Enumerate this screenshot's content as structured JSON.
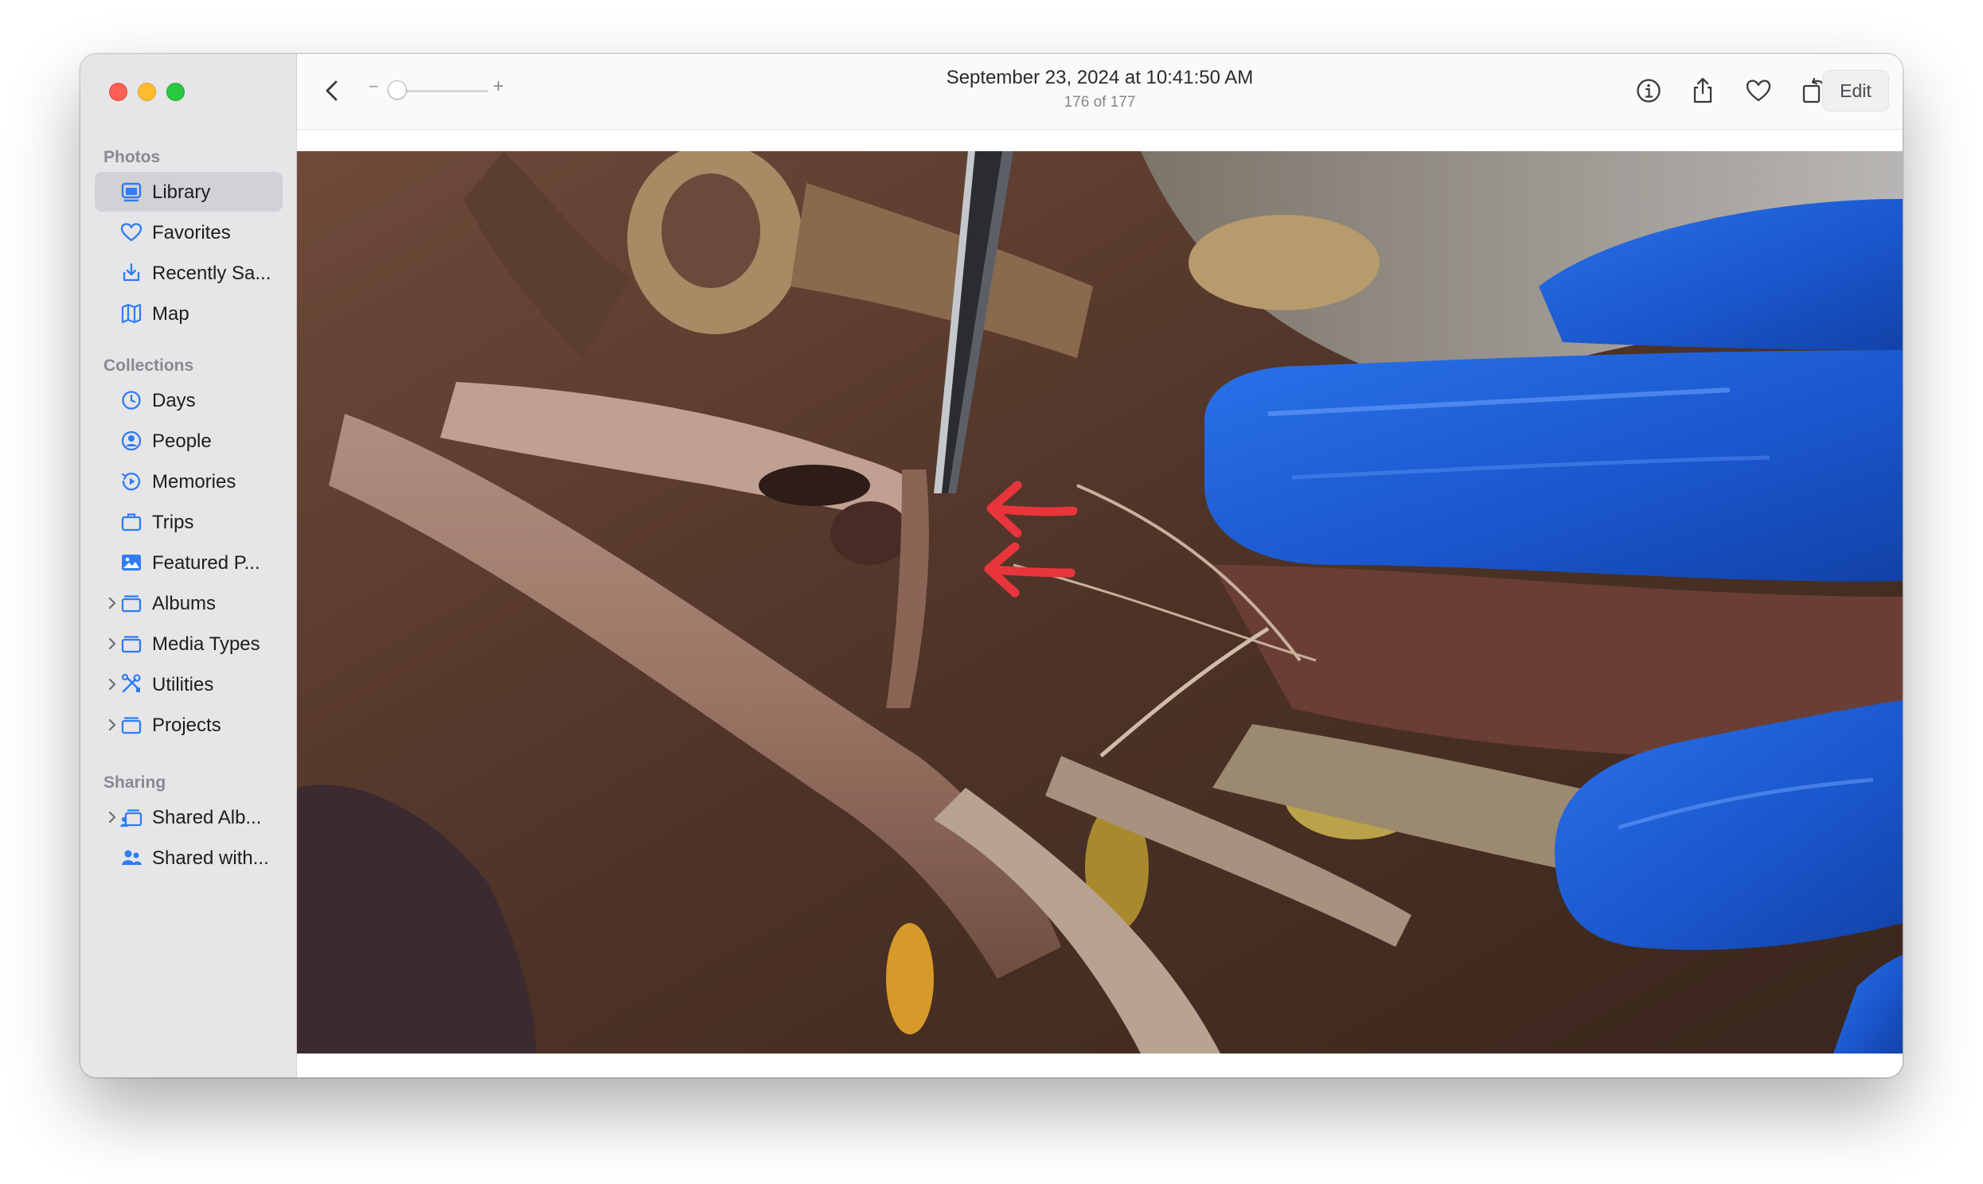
{
  "window": {
    "title_date": "September 23, 2024 at 10:41:50 AM",
    "photo_counter": "176 of 177"
  },
  "sidebar": {
    "sections": [
      {
        "title": "Photos"
      },
      {
        "title": "Collections"
      },
      {
        "title": "Sharing"
      }
    ],
    "photos_items": [
      {
        "label": "Library",
        "icon": "library-icon",
        "selected": true
      },
      {
        "label": "Favorites",
        "icon": "heart-icon"
      },
      {
        "label": "Recently Sa...",
        "icon": "download-icon"
      },
      {
        "label": "Map",
        "icon": "map-icon"
      }
    ],
    "collections_items": [
      {
        "label": "Days",
        "icon": "clock-icon"
      },
      {
        "label": "People",
        "icon": "person-icon"
      },
      {
        "label": "Memories",
        "icon": "memories-icon"
      },
      {
        "label": "Trips",
        "icon": "suitcase-icon"
      },
      {
        "label": "Featured P...",
        "icon": "photo-icon"
      },
      {
        "label": "Albums",
        "icon": "folder-icon",
        "expandable": true
      },
      {
        "label": "Media Types",
        "icon": "folder-icon",
        "expandable": true
      },
      {
        "label": "Utilities",
        "icon": "tools-icon",
        "expandable": true
      },
      {
        "label": "Projects",
        "icon": "folder-icon",
        "expandable": true
      }
    ],
    "sharing_items": [
      {
        "label": "Shared Alb...",
        "icon": "shared-album-icon",
        "expandable": true
      },
      {
        "label": "Shared with...",
        "icon": "shared-people-icon"
      }
    ]
  },
  "toolbar": {
    "zoom_minus": "−",
    "zoom_plus": "+",
    "zoom_level": 0,
    "edit_label": "Edit",
    "icons": [
      "info-icon",
      "share-icon",
      "favorite-icon",
      "rotate-icon",
      "enhance-icon"
    ]
  },
  "colors": {
    "accent": "#2f7cf6",
    "sidebar_bg": "#e6e5e8",
    "glove_blue": "#1e5fd6",
    "annotation_arrow": "#e8353b"
  }
}
